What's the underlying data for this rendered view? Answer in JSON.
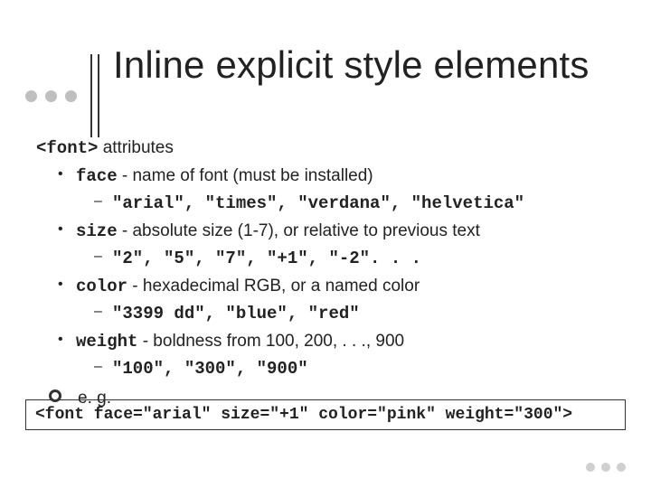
{
  "title": "Inline explicit style elements",
  "intro": {
    "tag": "<font>",
    "suffix": " attributes"
  },
  "attrs": {
    "face": {
      "name": "face",
      "desc": " - name of font (must be installed)",
      "example": "\"arial\", \"times\", \"verdana\", \"helvetica\""
    },
    "size": {
      "name": "size",
      "desc": " - absolute size (1-7), or relative to previous text",
      "example": "\"2\", \"5\", \"7\", \"+1\", \"-2\". . ."
    },
    "color": {
      "name": "color",
      "desc": " - hexadecimal RGB, or a named color",
      "example": "\"3399 dd\", \"blue\", \"red\""
    },
    "weight": {
      "name": "weight",
      "desc": " - boldness from 100, 200, . . ., 900",
      "example": "\"100\", \"300\", \"900\""
    }
  },
  "eg_label": "e. g.",
  "codebox": "<font face=\"arial\" size=\"+1\" color=\"pink\" weight=\"300\">"
}
